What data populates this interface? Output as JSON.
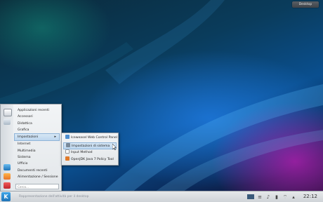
{
  "desktop": {
    "button_label": "Desktop"
  },
  "menu": {
    "items": [
      {
        "label": "Applicazioni recenti"
      },
      {
        "label": "Accessori"
      },
      {
        "label": "Didattica"
      },
      {
        "label": "Grafica"
      },
      {
        "label": "Impostazioni",
        "has_submenu": true
      },
      {
        "label": "Internet"
      },
      {
        "label": "Multimedia"
      },
      {
        "label": "Sistema"
      },
      {
        "label": "Ufficio"
      },
      {
        "label": "Documenti recenti"
      },
      {
        "label": "Alimentazione / Sessione"
      }
    ],
    "submenu_arrow": "▸",
    "search_placeholder": "Cerca..."
  },
  "submenu": {
    "items": [
      {
        "label": "Iceweasel Web Control Panel",
        "icon": "web-control-icon"
      },
      {
        "label": "Impostazioni di sistema",
        "icon": "system-settings-icon"
      },
      {
        "label": "Input Method",
        "icon": "input-method-icon"
      },
      {
        "label": "OpenJDK Java 7 Policy Tool",
        "icon": "java-icon"
      }
    ]
  },
  "taskbar": {
    "launcher_glyph": "K",
    "hint": "Rappresentazione dell'attività per il desktop",
    "clock": "22:12"
  },
  "colors": {
    "accent": "#1f74b8",
    "menu_highlight": "#bdd6ee"
  }
}
